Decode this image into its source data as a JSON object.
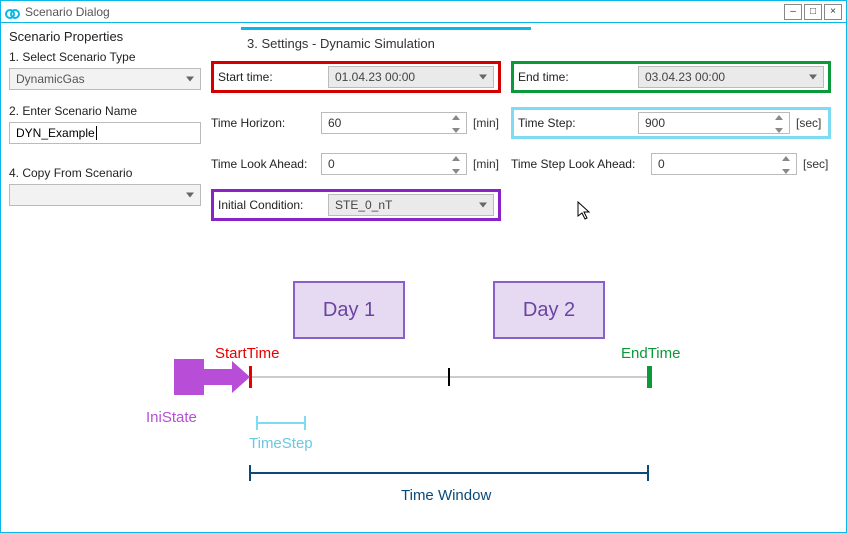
{
  "window": {
    "title": "Scenario Dialog",
    "buttons": {
      "min": "–",
      "max": "□",
      "close": "×"
    }
  },
  "sidebar": {
    "heading": "Scenario Properties",
    "step1_label": "1. Select Scenario Type",
    "step1_value": "DynamicGas",
    "step2_label": "2. Enter Scenario Name",
    "step2_value": "DYN_Example",
    "step4_label": "4. Copy From Scenario",
    "step4_value": ""
  },
  "section": {
    "title": "3. Settings - Dynamic Simulation"
  },
  "settings": {
    "start_time_label": "Start time:",
    "start_time_value": "01.04.23 00:00",
    "end_time_label": "End time:",
    "end_time_value": "03.04.23 00:00",
    "time_horizon_label": "Time Horizon:",
    "time_horizon_value": "60",
    "time_horizon_unit": "[min]",
    "time_step_label": "Time Step:",
    "time_step_value": "900",
    "time_step_unit": "[sec]",
    "time_look_ahead_label": "Time Look Ahead:",
    "time_look_ahead_value": "0",
    "time_look_ahead_unit": "[min]",
    "time_step_look_ahead_label": "Time Step Look Ahead:",
    "time_step_look_ahead_value": "0",
    "time_step_look_ahead_unit": "[sec]",
    "initial_condition_label": "Initial Condition:",
    "initial_condition_value": "STE_0_nT"
  },
  "diagram": {
    "day1": "Day 1",
    "day2": "Day 2",
    "start_label": "StartTime",
    "end_label": "EndTime",
    "ini_label": "IniState",
    "timestep_label": "TimeStep",
    "timewindow_label": "Time Window"
  }
}
